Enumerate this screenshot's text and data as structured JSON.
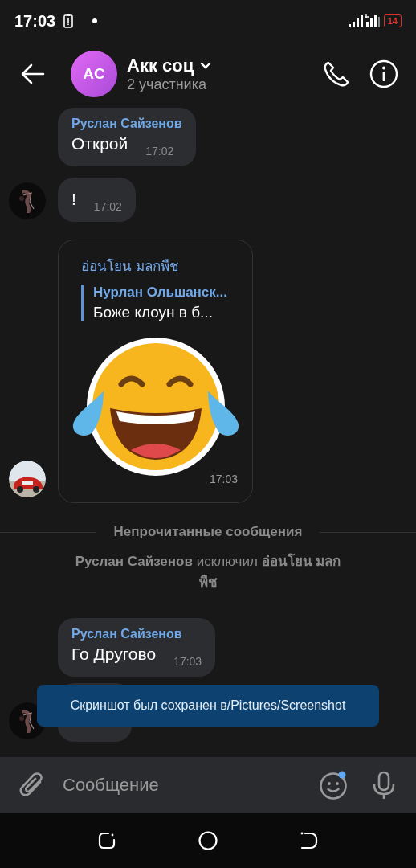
{
  "status_bar": {
    "time": "17:03",
    "battery": "14"
  },
  "header": {
    "avatar_initials": "AC",
    "title": "Акк соц",
    "subtitle": "2 участника"
  },
  "messages": [
    {
      "kind": "text",
      "sender": "Руслан Сайзенов",
      "text": "Открой",
      "time": "17:02",
      "avatar": false
    },
    {
      "kind": "text",
      "text": "!",
      "time": "17:02",
      "avatar": true
    },
    {
      "kind": "sticker",
      "sender": "อ่อนโยน มลกพืช",
      "reply": {
        "author": "Нурлан Ольшанск...",
        "text": "Боже клоун в б..."
      },
      "time": "17:03",
      "avatar": true
    },
    {
      "kind": "divider",
      "text": "Непрочитанные сообщения"
    },
    {
      "kind": "system",
      "text": "**Руслан Сайзенов** исключил **อ่อนโยน มลกพืช**"
    },
    {
      "kind": "text",
      "sender": "Руслан Сайзенов",
      "text": "Го Другово",
      "time": "17:03",
      "avatar": false
    },
    {
      "kind": "hidden",
      "avatar": true
    }
  ],
  "toast": "Скриншот был сохранен в/Pictures/Screenshot",
  "composer": {
    "placeholder": "Сообщение",
    "emoji_badge": true
  }
}
